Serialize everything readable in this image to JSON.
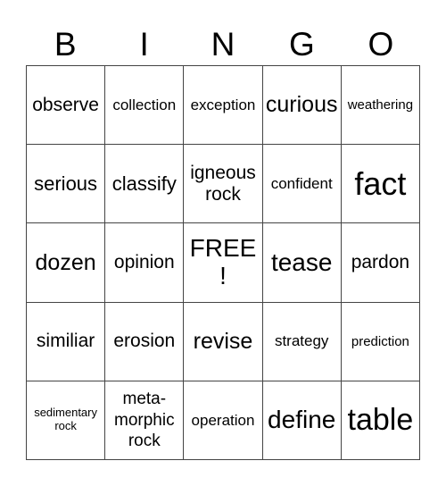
{
  "header": {
    "letters": [
      "B",
      "I",
      "N",
      "G",
      "O"
    ]
  },
  "board": {
    "rows": [
      [
        "observe",
        "collection",
        "exception",
        "curious",
        "weathering"
      ],
      [
        "serious",
        "classify",
        "igneous rock",
        "confident",
        "fact"
      ],
      [
        "dozen",
        "opinion",
        "FREE !",
        "tease",
        "pardon"
      ],
      [
        "similiar",
        "erosion",
        "revise",
        "strategy",
        "prediction"
      ],
      [
        "sedimentary rock",
        "meta-morphic rock",
        "operation",
        "define",
        "table"
      ]
    ]
  }
}
